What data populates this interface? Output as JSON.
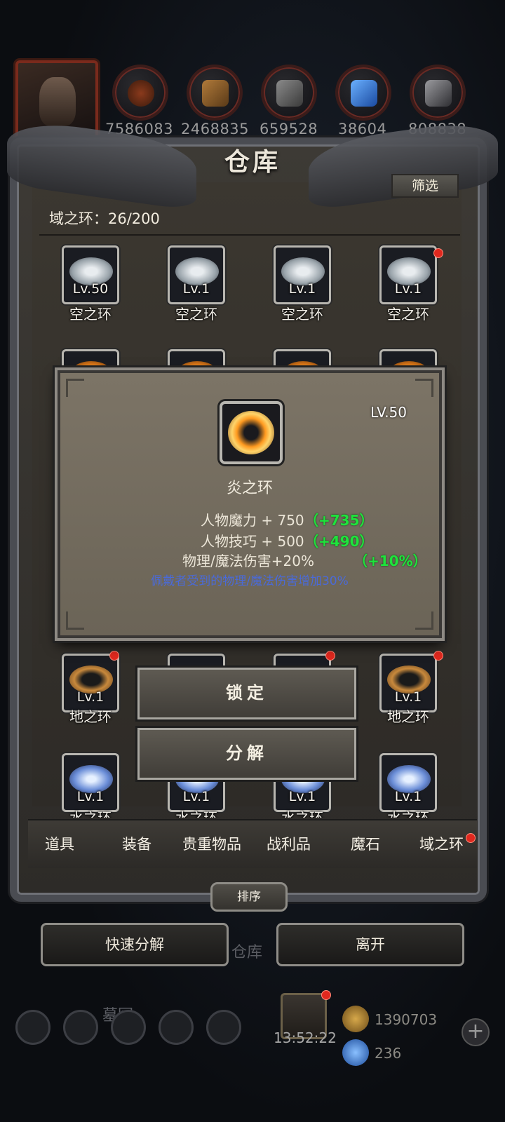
{
  "resources": [
    "7586083",
    "2468835",
    "659528",
    "38604",
    "808838"
  ],
  "title": "仓库",
  "filter_label": "筛选",
  "count_label": "域之环：26/200",
  "slots_row1": [
    {
      "lv": "Lv.50",
      "name": "空之环"
    },
    {
      "lv": "Lv.1",
      "name": "空之环"
    },
    {
      "lv": "Lv.1",
      "name": "空之环"
    },
    {
      "lv": "Lv.1",
      "name": "空之环"
    }
  ],
  "slots_row4": [
    {
      "lv": "Lv.1",
      "name": "地之环"
    },
    {
      "lv": "Lv.1",
      "name": "地之环"
    }
  ],
  "slots_row5": [
    {
      "lv": "Lv.1",
      "name": "水之环"
    },
    {
      "lv": "Lv.1",
      "name": "水之环"
    },
    {
      "lv": "Lv.1",
      "name": "水之环"
    },
    {
      "lv": "Lv.1",
      "name": "水之环"
    }
  ],
  "popup": {
    "level": "LV.50",
    "name": "炎之环",
    "stats": [
      {
        "text": "人物魔力 + 750",
        "bonus": "（+735）"
      },
      {
        "text": "人物技巧 + 500",
        "bonus": "（+490）"
      },
      {
        "text": "物理/魔法伤害+20%",
        "bonus": "（+10%）"
      }
    ],
    "effect": "佩戴者受到的物理/魔法伤害增加30%"
  },
  "actions": {
    "lock": "锁定",
    "decompose": "分解"
  },
  "tabs": [
    "道具",
    "装备",
    "贵重物品",
    "战利品",
    "魔石",
    "域之环"
  ],
  "sort_label": "排序",
  "bottom": {
    "quick_decompose": "快速分解",
    "leave": "离开"
  },
  "background": {
    "warehouse": "仓库",
    "cemetery": "墓园"
  },
  "timer": "13:52:22",
  "currency": {
    "gold": "1390703",
    "gems": "236"
  }
}
